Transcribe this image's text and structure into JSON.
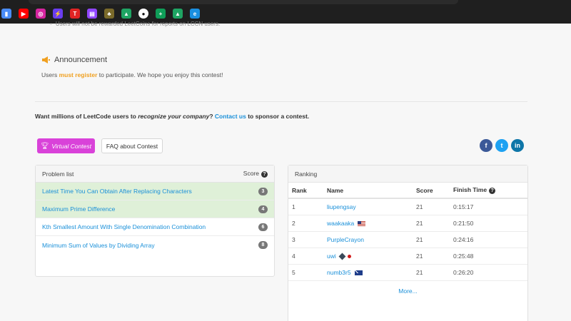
{
  "bookmarks": [
    {
      "name": "analytics-bookmark",
      "color": "#4a8cf7",
      "glyph": "▮"
    },
    {
      "name": "youtube-bookmark",
      "color": "#ff0000",
      "glyph": "▶"
    },
    {
      "name": "instagram-bookmark",
      "color": "#d6249f",
      "glyph": "◎"
    },
    {
      "name": "bolt-bookmark",
      "color": "#6a3df0",
      "glyph": "⚡"
    },
    {
      "name": "tuf-bookmark",
      "color": "#e02424",
      "glyph": "T"
    },
    {
      "name": "twitch-bookmark",
      "color": "#9146ff",
      "glyph": "▤"
    },
    {
      "name": "game-bookmark",
      "color": "#7a6a2a",
      "glyph": "♣"
    },
    {
      "name": "google-drive-bookmark",
      "color": "#1fa463",
      "glyph": "▲"
    },
    {
      "name": "github-bookmark",
      "color": "#ffffff",
      "glyph": "●"
    },
    {
      "name": "sheets-bookmark",
      "color": "#0f9d58",
      "glyph": "+"
    },
    {
      "name": "google-drive-bookmark-2",
      "color": "#1fa463",
      "glyph": "▲"
    },
    {
      "name": "edge-bookmark",
      "color": "#1a8fe0",
      "glyph": "e"
    }
  ],
  "cut_text": "Users will not be rewarded LeetCoins for reports on LCCN users.",
  "announcement": {
    "title": "Announcement",
    "text_before": "Users ",
    "highlight": "must register",
    "text_after": " to participate. We hope you enjoy this contest!"
  },
  "sponsor": {
    "part1": "Want millions of LeetCode users to ",
    "emphasis": "recognize your company",
    "part2": "? ",
    "link": "Contact us",
    "part3": " to sponsor a contest."
  },
  "buttons": {
    "virtual_label": "Virtual Contest",
    "faq_label": "FAQ about Contest"
  },
  "social": {
    "fb": "f",
    "tw": "t",
    "li": "in"
  },
  "problem_list": {
    "title": "Problem list",
    "score_header": "Score",
    "problems": [
      {
        "title": "Latest Time You Can Obtain After Replacing Characters",
        "score": "3",
        "solved": true
      },
      {
        "title": "Maximum Prime Difference",
        "score": "4",
        "solved": true
      },
      {
        "title": "Kth Smallest Amount With Single Denomination Combination",
        "score": "6",
        "solved": false
      },
      {
        "title": "Minimum Sum of Values by Dividing Array",
        "score": "8",
        "solved": false
      }
    ]
  },
  "ranking": {
    "title": "Ranking",
    "headers": {
      "rank": "Rank",
      "name": "Name",
      "score": "Score",
      "finish": "Finish Time"
    },
    "rows": [
      {
        "rank": "1",
        "name": "liupengsay",
        "score": "21",
        "finish": "0:15:17",
        "flag": ""
      },
      {
        "rank": "2",
        "name": "waakaaka",
        "score": "21",
        "finish": "0:21:50",
        "flag": "us"
      },
      {
        "rank": "3",
        "name": "PurpleCrayon",
        "score": "21",
        "finish": "0:24:16",
        "flag": ""
      },
      {
        "rank": "4",
        "name": "uwi",
        "score": "21",
        "finish": "0:25:48",
        "flag": "jp"
      },
      {
        "rank": "5",
        "name": "numb3r5",
        "score": "21",
        "finish": "0:26:20",
        "flag": "au"
      }
    ],
    "more_label": "More..."
  }
}
